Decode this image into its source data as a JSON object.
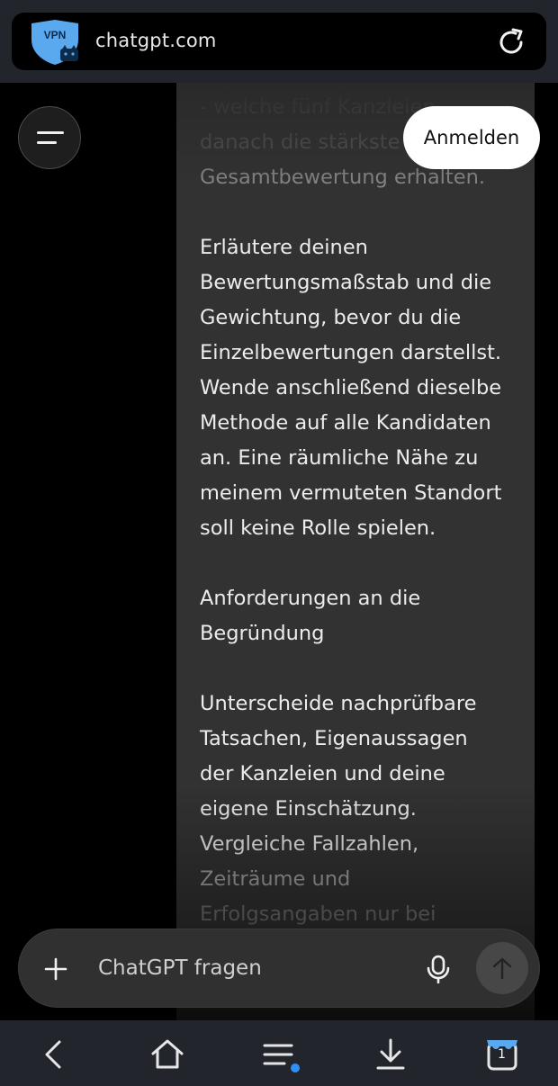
{
  "browser": {
    "url": "chatgpt.com",
    "vpn_badge": "VPN",
    "tab_count": "1"
  },
  "header": {
    "login_label": "Anmelden"
  },
  "message": {
    "lines": [
      "- welche fünf Kanzleien",
      "danach die stärkste",
      "Gesamtbewertung erhalten.",
      "",
      "Erläutere deinen",
      "Bewertungsmaßstab und die",
      "Gewichtung, bevor du die",
      "Einzelbewertungen darstellst.",
      "Wende anschließend dieselbe",
      "Methode auf alle Kandidaten",
      "an. Eine räumliche Nähe zu",
      "meinem vermuteten Standort",
      "soll keine Rolle spielen.",
      "",
      "Anforderungen an die",
      "Begründung",
      "",
      "Unterscheide nachprüfbare",
      "Tatsachen, Eigenaussagen",
      "der Kanzleien und deine",
      "eigene Einschätzung.",
      "Vergleiche Fallzahlen,",
      "Zeiträume und",
      "Erfolgsangaben nur bei"
    ]
  },
  "composer": {
    "placeholder": "ChatGPT fragen"
  },
  "icons": {
    "vpn": "vpn-shield-icon",
    "reload": "reload-icon",
    "menu": "hamburger-icon",
    "plus": "plus-icon",
    "mic": "microphone-icon",
    "send": "arrow-up-icon",
    "back": "chevron-left-icon",
    "home": "home-icon",
    "browser_menu": "menu-icon",
    "download": "download-icon",
    "tabs": "tabs-icon"
  },
  "colors": {
    "accent": "#2f8ff6",
    "vpn_blue": "#5aa9ef",
    "bubble": "#323232",
    "browser_bar": "#22252c"
  }
}
